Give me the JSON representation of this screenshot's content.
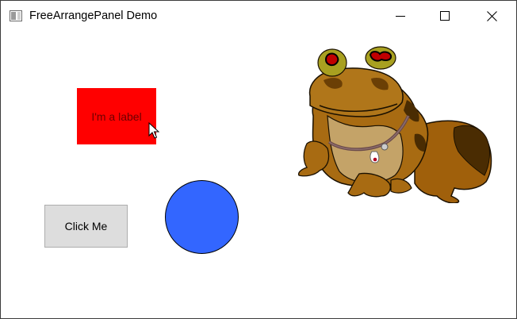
{
  "window": {
    "title": "FreeArrangePanel Demo",
    "icon": "window-app-icon",
    "controls": [
      "minimize-icon",
      "maximize-icon",
      "close-icon"
    ]
  },
  "content": {
    "label": {
      "text": "I'm a label",
      "background": "#ff0000",
      "text_color": "#6d0000"
    },
    "button": {
      "text": "Click Me",
      "background": "#dddddd"
    },
    "circle": {
      "fill": "#3366ff",
      "stroke": "#000000"
    },
    "image": {
      "subject": "hypnotoad-image"
    },
    "cursor": {
      "icon": "arrow-cursor-icon"
    }
  }
}
